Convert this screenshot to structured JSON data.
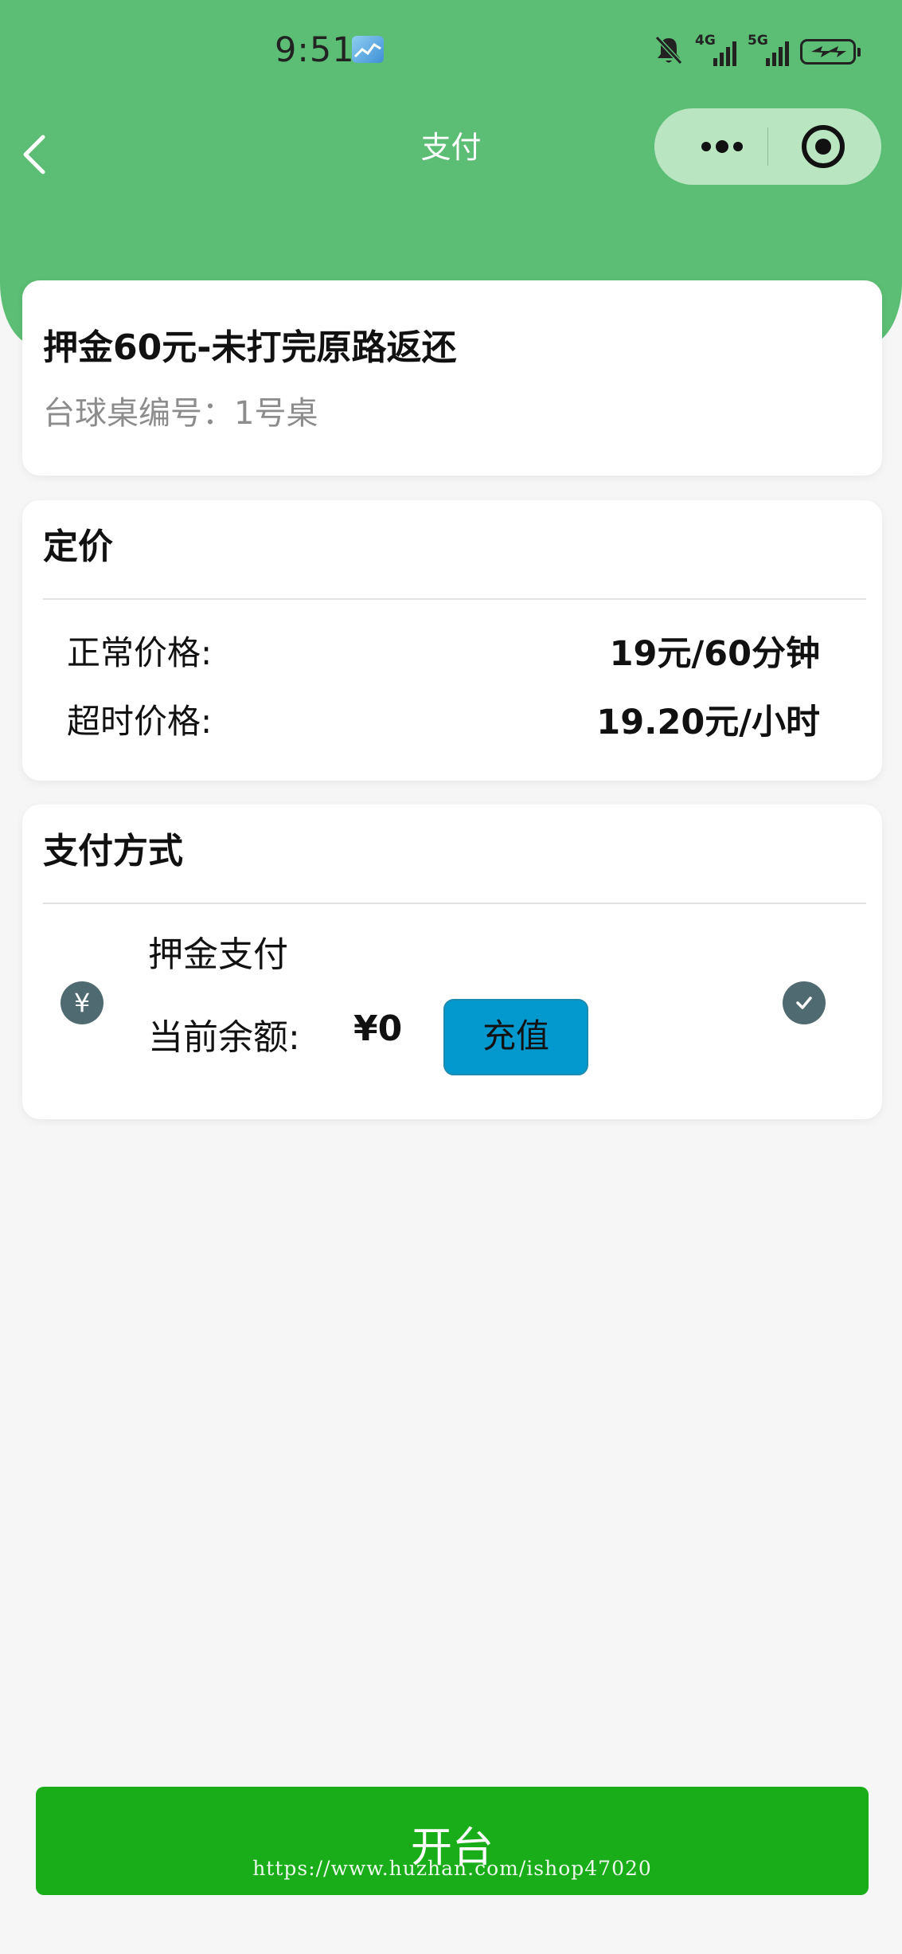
{
  "status_bar": {
    "time": "9:51",
    "signal_1_label": "4G",
    "signal_2_label": "5G"
  },
  "nav": {
    "title": "支付"
  },
  "package": {
    "title": "押金60元-未打完原路返还",
    "table_label": "台球桌编号：",
    "table_value": "1号桌"
  },
  "pricing": {
    "title": "定价",
    "normal_label": "正常价格:",
    "normal_value": "19元/60分钟",
    "overtime_label": "超时价格:",
    "overtime_value": "19.20元/小时"
  },
  "payment": {
    "title": "支付方式",
    "method_icon_glyph": "¥",
    "method_name": "押金支付",
    "balance_label": "当前余额:",
    "balance_value": "¥0",
    "recharge_label": "充值",
    "selected": true
  },
  "footer": {
    "open_label": "开台",
    "watermark": "https://www.huzhan.com/ishop47020"
  },
  "colors": {
    "header_green": "#5cbd74",
    "capsule_bg": "#b9e5c1",
    "recharge_blue": "#0399cf",
    "primary_green": "#19ad19",
    "icon_slate": "#4f6a70",
    "page_bg": "#f6f6f6"
  },
  "icons": {
    "back": "chevron-left-icon",
    "more": "more-dots-icon",
    "close": "target-close-icon",
    "method": "yen-coin-icon",
    "check": "check-circle-icon",
    "mute": "bell-off-icon",
    "battery": "battery-charging-icon"
  }
}
